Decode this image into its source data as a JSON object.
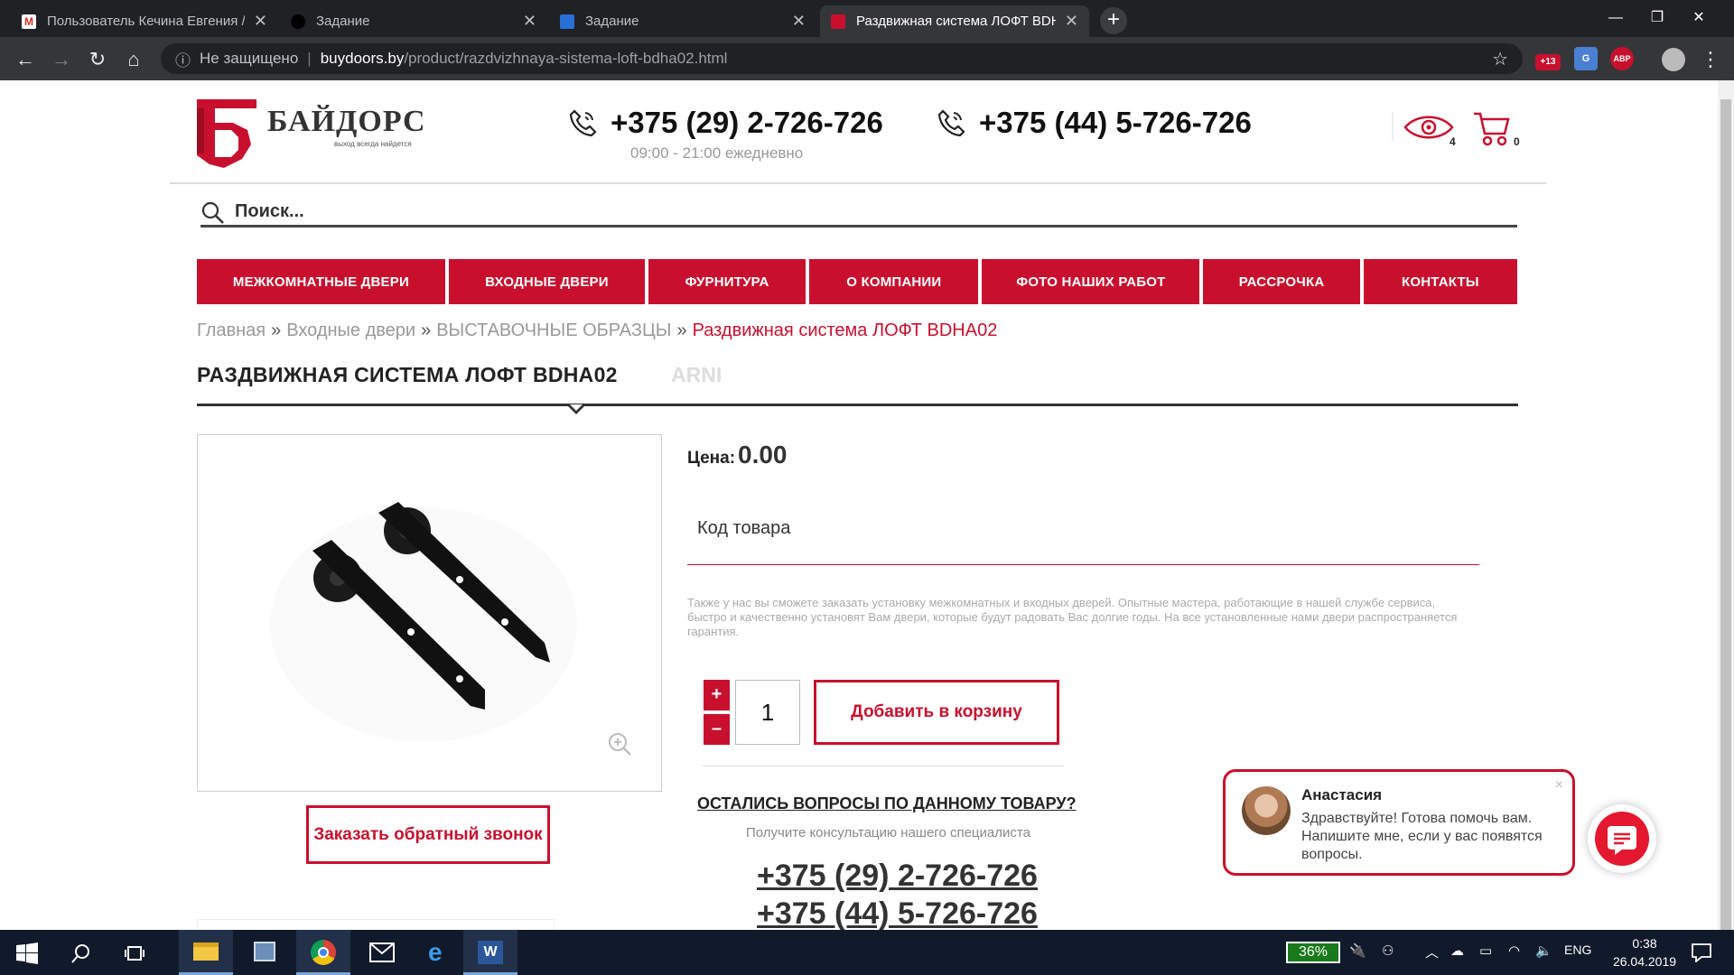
{
  "browser": {
    "tabs": [
      {
        "title": "Пользователь Кечина Евгения /",
        "active": false
      },
      {
        "title": "Задание",
        "active": false
      },
      {
        "title": "Задание",
        "active": false
      },
      {
        "title": "Раздвижная система ЛОФТ BDH",
        "active": true
      }
    ],
    "new_tab": "+",
    "url_security": "Не защищено",
    "url_domain": "buydoors.by",
    "url_path": "/product/razdvizhnaya-sistema-loft-bdha02.html",
    "ext_badge": "+13",
    "ext_abp": "ABP"
  },
  "header": {
    "logo_text": "БАЙДОРС",
    "logo_sub": "выход всегда найдется",
    "phone1": "+375 (29) 2-726-726",
    "phone2": "+375 (44) 5-726-726",
    "hours": "09:00 - 21:00 ежедневно",
    "viewed_count": "4",
    "cart_count": "0",
    "search_placeholder": "Поиск..."
  },
  "menu": [
    {
      "label": "Межкомнатные двери"
    },
    {
      "label": "Входные двери"
    },
    {
      "label": "Фурнитура"
    },
    {
      "label": "О компании"
    },
    {
      "label": "Фото наших работ"
    },
    {
      "label": "Рассрочка"
    },
    {
      "label": "Контакты"
    }
  ],
  "breadcrumb": {
    "items": [
      "Главная",
      "Входные двери",
      "ВЫСТАВОЧНЫЕ ОБРАЗЦЫ"
    ],
    "current": "Раздвижная система ЛОФТ BDHA02",
    "separator": "»"
  },
  "product": {
    "title": "РАЗДВИЖНАЯ СИСТЕМА ЛОФТ BDHA02",
    "brand": "ARNI",
    "price_label": "Цена:",
    "price_value": "0.00",
    "code_label": "Код товара",
    "note": "Также у нас вы сможете заказать установку межкомнатных и входных дверей. Опытные мастера, работающие в нашей службе сервиса, быстро и качественно установят Вам двери, которые будут радовать Вас долгие годы. На все установленные нами двери распространяется гарантия.",
    "qty_plus": "+",
    "qty_minus": "–",
    "qty": "1",
    "add_to_cart": "Добавить в корзину",
    "callback": "Заказать обратный звонок",
    "questions_title": "ОСТАЛИСЬ ВОПРОСЫ ПО ДАННОМУ ТОВАРУ?",
    "questions_sub": "Получите консультацию нашего специалиста",
    "phone1": "+375 (29) 2-726-726",
    "phone2": "+375 (44) 5-726-726"
  },
  "chat": {
    "name": "Анастасия",
    "message": "Здравствуйте! Готова помочь вам. Напишите мне, если у вас появятся вопросы.",
    "close": "×"
  },
  "taskbar": {
    "battery": "36%",
    "lang": "ENG",
    "time": "0:38",
    "date": "26.04.2019"
  },
  "colors": {
    "brand_red": "#c8102e",
    "chrome_dark": "#202124",
    "taskbar": "#101a2b"
  }
}
